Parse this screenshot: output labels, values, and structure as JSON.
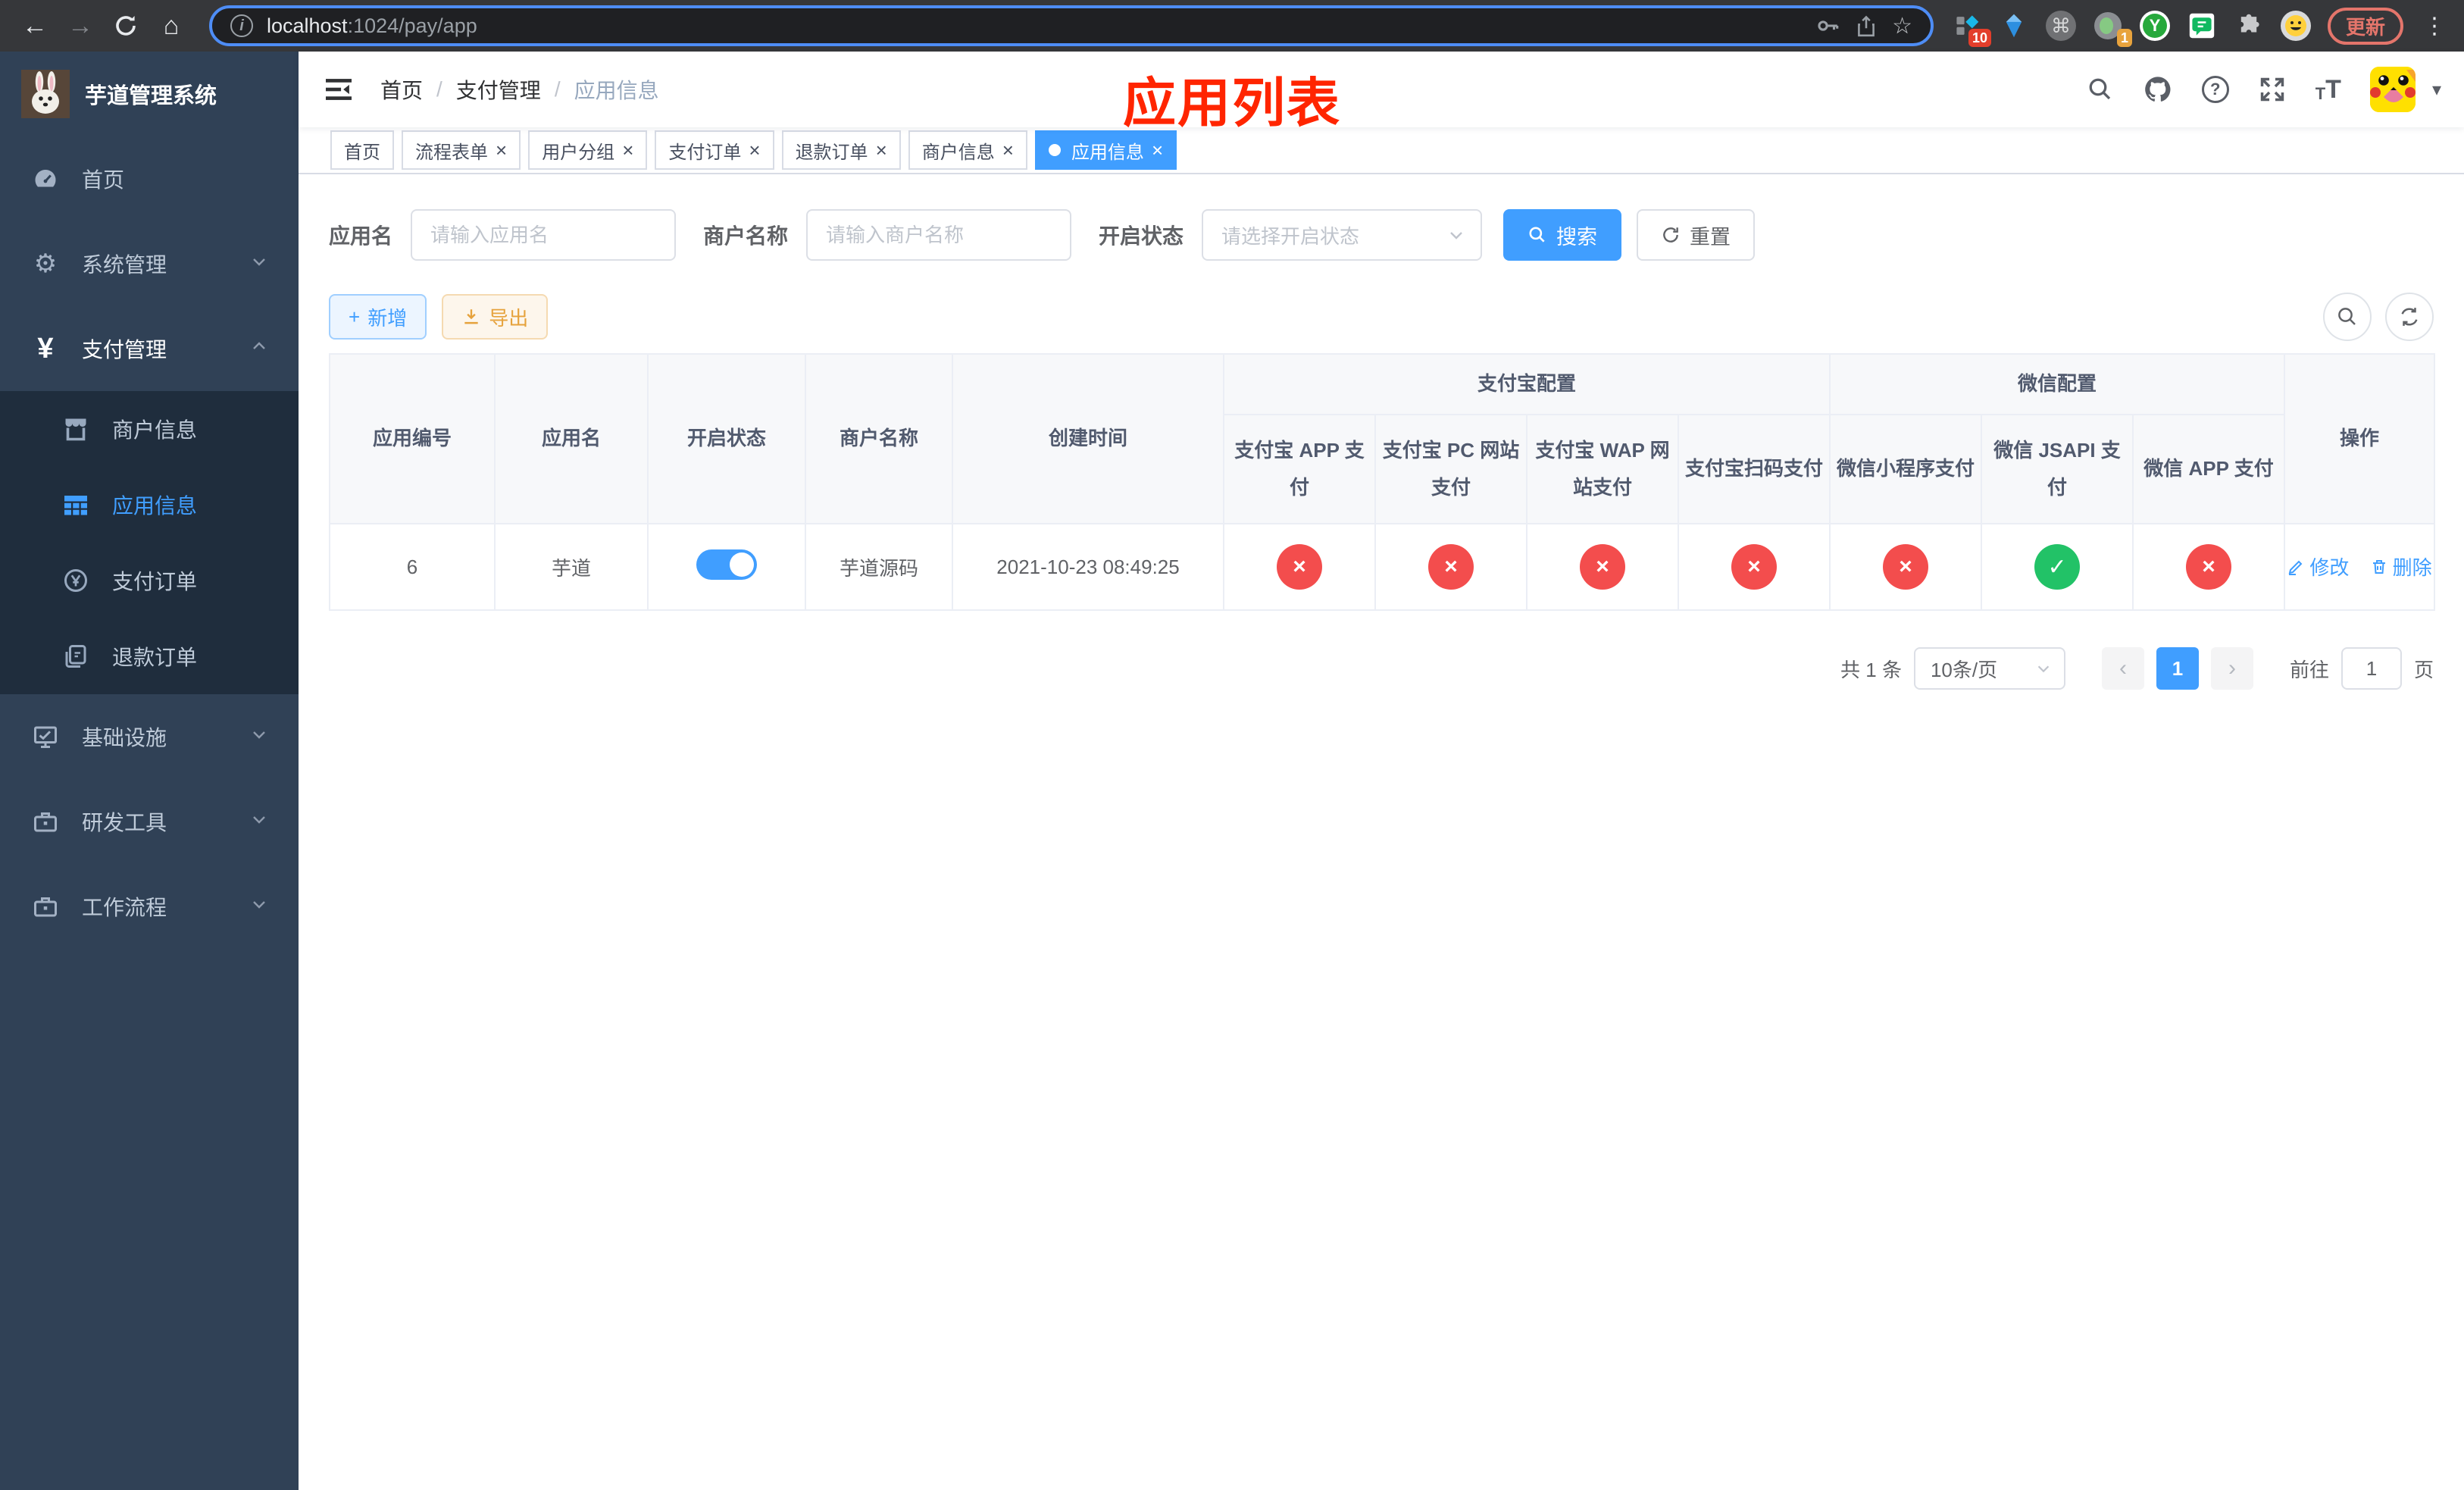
{
  "browser": {
    "url": {
      "host": "localhost",
      "path": ":1024/pay/app"
    },
    "extensions": {
      "badge_ten": "10",
      "badge_one": "1",
      "y_letter": "Y",
      "update_label": "更新"
    }
  },
  "icons": {
    "back": "←",
    "forward": "→",
    "home": "⌂",
    "info": "i",
    "star": "☆",
    "command": "⌘",
    "kebab": "⋮",
    "caret": "▾",
    "sep": "/",
    "close": "×",
    "plus": "+",
    "check": "✓",
    "cross": "×",
    "yen": "¥",
    "question": "?",
    "font_small": "T",
    "font_large": "T"
  },
  "sidebar": {
    "title": "芋道管理系统",
    "items": [
      {
        "label": "首页"
      },
      {
        "label": "系统管理"
      },
      {
        "label": "支付管理"
      },
      {
        "label": "商户信息"
      },
      {
        "label": "应用信息"
      },
      {
        "label": "支付订单"
      },
      {
        "label": "退款订单"
      },
      {
        "label": "基础设施"
      },
      {
        "label": "研发工具"
      },
      {
        "label": "工作流程"
      }
    ]
  },
  "navbar": {
    "breadcrumb": [
      "首页",
      "支付管理",
      "应用信息"
    ]
  },
  "annotation": "应用列表",
  "tabs": [
    {
      "label": "首页"
    },
    {
      "label": "流程表单"
    },
    {
      "label": "用户分组"
    },
    {
      "label": "支付订单"
    },
    {
      "label": "退款订单"
    },
    {
      "label": "商户信息"
    },
    {
      "label": "应用信息"
    }
  ],
  "filters": {
    "app_name": {
      "label": "应用名",
      "placeholder": "请输入应用名"
    },
    "merchant_name": {
      "label": "商户名称",
      "placeholder": "请输入商户名称"
    },
    "status": {
      "label": "开启状态",
      "placeholder": "请选择开启状态"
    },
    "search_label": "搜索",
    "reset_label": "重置"
  },
  "toolbar": {
    "add_label": "新增",
    "export_label": "导出"
  },
  "table": {
    "columns": {
      "id": "应用编号",
      "name": "应用名",
      "enabled": "开启状态",
      "merchant": "商户名称",
      "created": "创建时间",
      "alipay_group": "支付宝配置",
      "alipay": [
        "支付宝 APP 支付",
        "支付宝 PC 网站支付",
        "支付宝 WAP 网站支付",
        "支付宝扫码支付"
      ],
      "wechat_group": "微信配置",
      "wechat": [
        "微信小程序支付",
        "微信 JSAPI 支付",
        "微信 APP 支付"
      ],
      "actions": "操作"
    },
    "row": {
      "id": "6",
      "name": "芋道",
      "enabled": true,
      "merchant": "芋道源码",
      "created": "2021-10-23 08:49:25",
      "statuses": [
        false,
        false,
        false,
        false,
        false,
        true,
        false
      ],
      "edit_label": "修改",
      "delete_label": "删除"
    }
  },
  "pagination": {
    "total": "共 1 条",
    "page_size": "10条/页",
    "prev": "‹",
    "page": "1",
    "next": "›",
    "goto": "前往",
    "goto_value": "1",
    "unit": "页"
  },
  "colors": {
    "accent": "#409eff",
    "success": "#22c267",
    "danger": "#f34d4d",
    "sidebar_bg": "#304156",
    "submenu_bg": "#1f2d3d"
  }
}
